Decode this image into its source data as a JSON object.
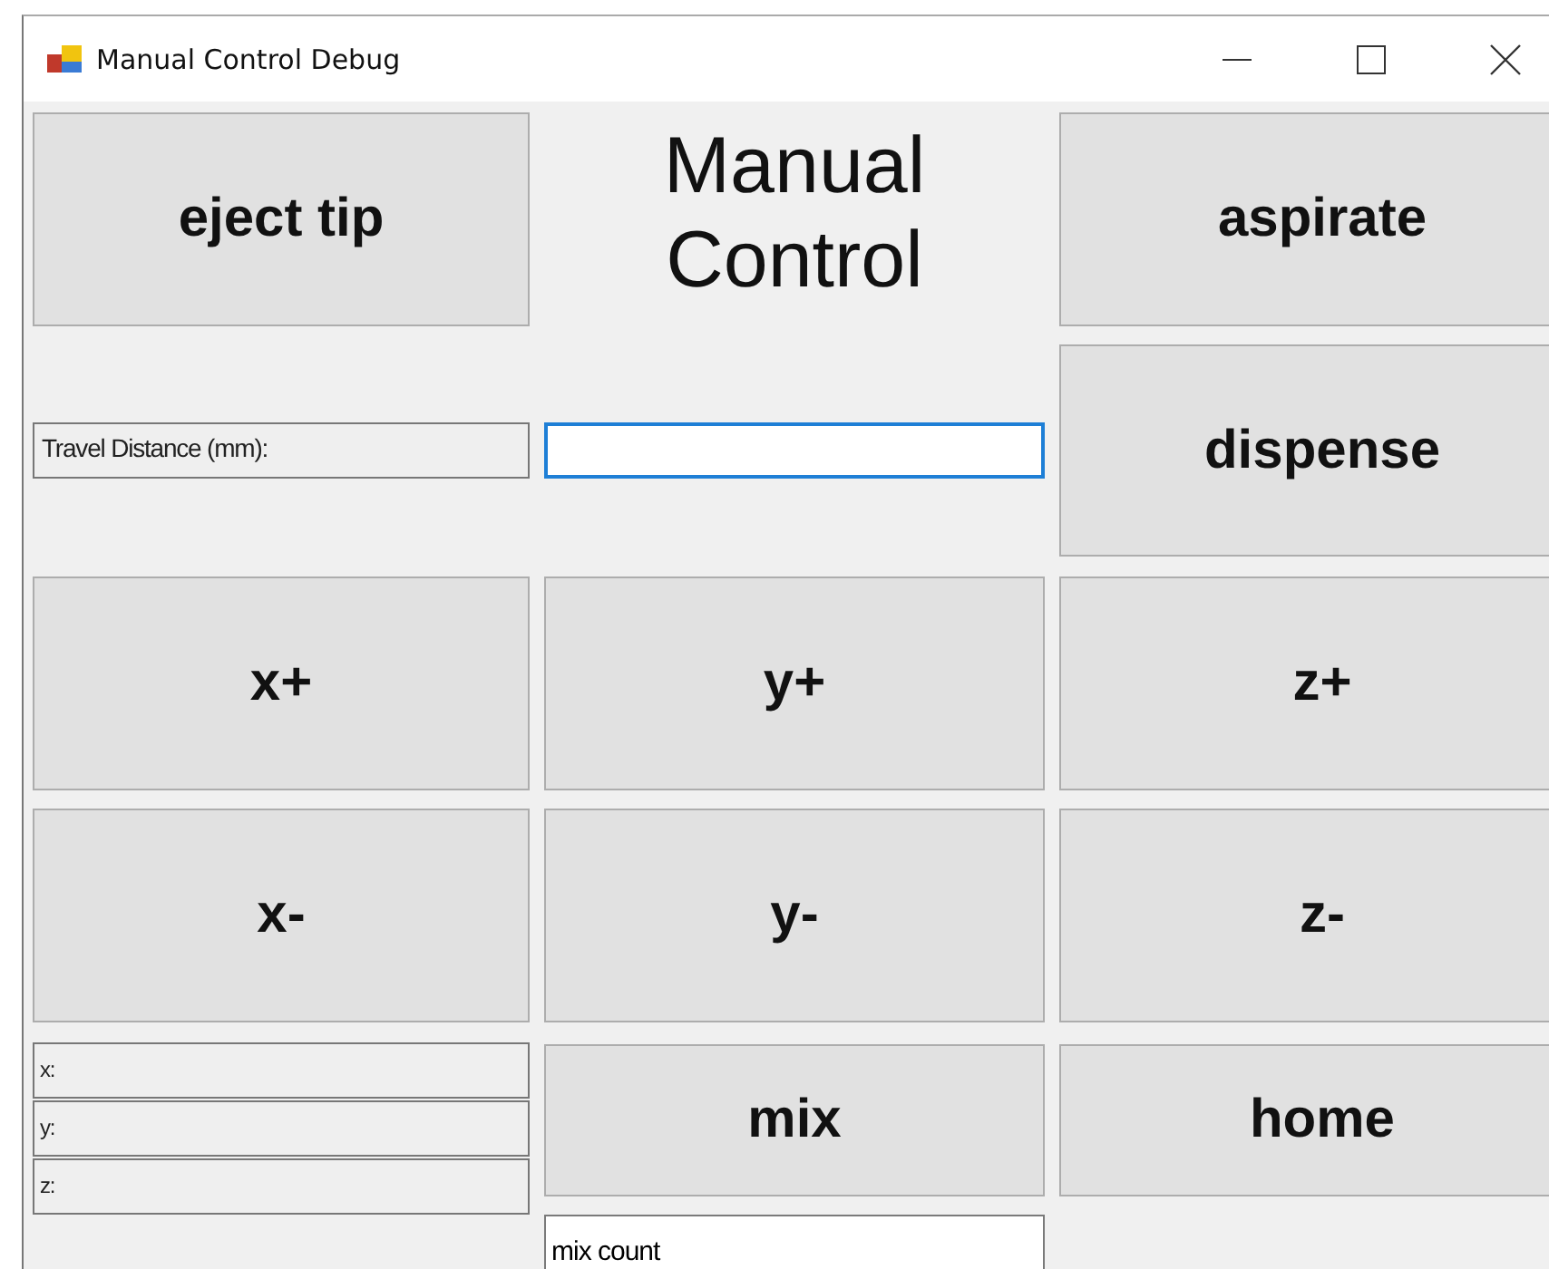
{
  "window": {
    "title": "Manual Control Debug"
  },
  "eject_button": "eject tip",
  "heading": "Manual\nControl",
  "aspirate_button": "aspirate",
  "travel_label": "Travel Distance (mm):",
  "travel_field": {
    "focused": true
  },
  "dispense_button": "dispense",
  "jog_buttons": [
    "x+",
    "y+",
    "z+",
    "x-",
    "y-",
    "z-"
  ],
  "coordinates": [
    "x:",
    "y:",
    "z:"
  ],
  "mix_button": "mix",
  "home_button": "home",
  "mix_count_field": {
    "value": "mix count",
    "focused": false
  }
}
